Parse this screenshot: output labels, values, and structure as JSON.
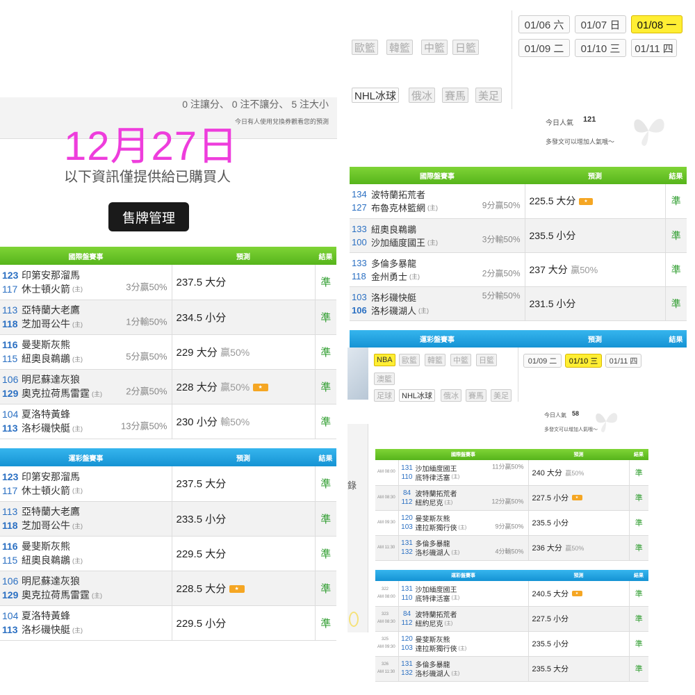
{
  "left": {
    "counts": "0 注讓分、 0 注不讓分、 5 注大小",
    "hint": "今日有人使用兌換券觀看您的預測",
    "date": "12月27日",
    "subtitle": "以下資訊僅提供給已購買人",
    "manage_button": "售牌管理",
    "tables": [
      {
        "title": "國際盤賽事",
        "col_pred": "預測",
        "col_result": "結果",
        "rows": [
          {
            "n1": "123",
            "t1": "印第安那溜馬",
            "n2": "117",
            "t2": "休士頓火箭",
            "host": "(主)",
            "host_row": 2,
            "bold": 1,
            "note": "3分贏50%",
            "pred": "237.5 大分",
            "pct": "",
            "badge": false,
            "result": "準"
          },
          {
            "n1": "113",
            "t1": "亞特蘭大老鷹",
            "n2": "118",
            "t2": "芝加哥公牛",
            "host": "(主)",
            "host_row": 2,
            "bold": 2,
            "note": "1分輸50%",
            "pred": "234.5 小分",
            "pct": "",
            "badge": false,
            "result": "準"
          },
          {
            "n1": "116",
            "t1": "曼斐斯灰熊",
            "n2": "115",
            "t2": "紐奧良鵜鶘",
            "host": "(主)",
            "host_row": 2,
            "bold": 1,
            "note": "5分贏50%",
            "pred": "229 大分",
            "pct": "贏50%",
            "badge": false,
            "result": "準"
          },
          {
            "n1": "106",
            "t1": "明尼蘇達灰狼",
            "n2": "129",
            "t2": "奧克拉荷馬雷霆",
            "host": "(主)",
            "host_row": 2,
            "bold": 2,
            "note": "2分贏50%",
            "pred": "228 大分",
            "pct": "贏50%",
            "badge": true,
            "result": "準"
          },
          {
            "n1": "104",
            "t1": "夏洛特黃蜂",
            "n2": "113",
            "t2": "洛杉磯快艇",
            "host": "(主)",
            "host_row": 2,
            "bold": 2,
            "note": "13分贏50%",
            "pred": "230 小分",
            "pct": "輸50%",
            "badge": false,
            "result": "準"
          }
        ]
      },
      {
        "title": "運彩盤賽事",
        "col_pred": "預測",
        "col_result": "結果",
        "rows": [
          {
            "n1": "123",
            "t1": "印第安那溜馬",
            "n2": "117",
            "t2": "休士頓火箭",
            "host": "(主)",
            "host_row": 2,
            "bold": 1,
            "note": "",
            "pred": "237.5 大分",
            "pct": "",
            "badge": false,
            "result": "準"
          },
          {
            "n1": "113",
            "t1": "亞特蘭大老鷹",
            "n2": "118",
            "t2": "芝加哥公牛",
            "host": "(主)",
            "host_row": 2,
            "bold": 2,
            "note": "",
            "pred": "233.5 小分",
            "pct": "",
            "badge": false,
            "result": "準"
          },
          {
            "n1": "116",
            "t1": "曼斐斯灰熊",
            "n2": "115",
            "t2": "紐奧良鵜鶘",
            "host": "(主)",
            "host_row": 2,
            "bold": 1,
            "note": "",
            "pred": "229.5 大分",
            "pct": "",
            "badge": false,
            "result": "準"
          },
          {
            "n1": "106",
            "t1": "明尼蘇達灰狼",
            "n2": "129",
            "t2": "奧克拉荷馬雷霆",
            "host": "(主)",
            "host_row": 2,
            "bold": 2,
            "note": "",
            "pred": "228.5 大分",
            "pct": "",
            "badge": true,
            "result": "準"
          },
          {
            "n1": "104",
            "t1": "夏洛特黃蜂",
            "n2": "113",
            "t2": "洛杉磯快艇",
            "host": "(主)",
            "host_row": 2,
            "bold": 2,
            "note": "",
            "pred": "229.5 小分",
            "pct": "",
            "badge": false,
            "result": "準"
          }
        ]
      }
    ]
  },
  "rtop": {
    "dates": [
      "01/06 六",
      "01/07 日",
      "01/08 一",
      "01/09 二",
      "01/10 三",
      "01/11 四"
    ],
    "sports_row1": [
      "歐籃",
      "韓籃",
      "中籃",
      "日籃"
    ],
    "sports_row2": [
      "NHL冰球",
      "俄冰",
      "賽馬",
      "美足"
    ],
    "pop_label": "今日人氣",
    "pop_value": "121",
    "pop_hint": "多發文可以增加人氣哦～",
    "table": {
      "title": "國際盤賽事",
      "col_pred": "預測",
      "col_result": "結果",
      "rows": [
        {
          "n1": "134",
          "t1": "波特蘭拓荒者",
          "n2": "127",
          "t2": "布魯克林籃網",
          "host": "(主)",
          "host_row": 2,
          "bold": 0,
          "note": "9分贏50%",
          "note_row": 2,
          "pred": "225.5 大分",
          "pct": "",
          "badge": true,
          "result": "準"
        },
        {
          "n1": "133",
          "t1": "紐奧良鵜鶘",
          "n2": "100",
          "t2": "沙加緬度國王",
          "host": "(主)",
          "host_row": 2,
          "bold": 0,
          "note": "3分輸50%",
          "note_row": 2,
          "pred": "235.5 小分",
          "pct": "",
          "badge": false,
          "result": "準"
        },
        {
          "n1": "133",
          "t1": "多倫多暴龍",
          "n2": "118",
          "t2": "金州勇士",
          "host": "(主)",
          "host_row": 2,
          "bold": 0,
          "note": "2分贏50%",
          "note_row": 2,
          "pred": "237 大分",
          "pct": "贏50%",
          "badge": false,
          "result": "準"
        },
        {
          "n1": "103",
          "t1": "洛杉磯快艇",
          "n2": "106",
          "t2": "洛杉磯湖人",
          "host": "(主)",
          "host_row": 2,
          "bold": 2,
          "note": "5分輸50%",
          "note_row": 1,
          "pred": "231.5 小分",
          "pct": "",
          "badge": false,
          "result": "準"
        }
      ]
    },
    "blue_header": {
      "title": "運彩盤賽事",
      "col_pred": "預測",
      "col_result": "結果"
    }
  },
  "rbot": {
    "dates": [
      "01/09 二",
      "01/10 三",
      "01/11 四"
    ],
    "sports_row1": [
      "NBA",
      "歐籃",
      "韓籃",
      "中籃",
      "日籃"
    ],
    "sports_row2": [
      "澳籃"
    ],
    "sports_row3": [
      "足球",
      "NHL冰球",
      "俄冰",
      "賽馬",
      "美足"
    ],
    "side_text": "錄",
    "pop_label": "今日人氣",
    "pop_value": "58",
    "pop_hint": "多發文可以增加人氣哦～",
    "tables": [
      {
        "title": "國際盤賽事",
        "col_pred": "預測",
        "col_result": "結果",
        "rows": [
          {
            "code": "",
            "time": "AM 08:00",
            "n1": "131",
            "t1": "沙加緬度國王",
            "n2": "110",
            "t2": "底特律活塞",
            "host": "(主)",
            "note": "11分贏50%",
            "note_row": 1,
            "pred": "240 大分",
            "pct": "贏50%",
            "badge": false,
            "result": "準"
          },
          {
            "code": "",
            "time": "AM 08:30",
            "n1": "84",
            "t1": "波特蘭拓荒者",
            "n2": "112",
            "t2": "紐約尼克",
            "host": "(主)",
            "note": "12分贏50%",
            "note_row": 2,
            "pred": "227.5 小分",
            "pct": "",
            "badge": true,
            "result": "準"
          },
          {
            "code": "",
            "time": "AM 09:30",
            "n1": "120",
            "t1": "曼斐斯灰熊",
            "n2": "103",
            "t2": "達拉斯獨行俠",
            "host": "(主)",
            "note": "9分贏50%",
            "note_row": 2,
            "pred": "235.5 小分",
            "pct": "",
            "badge": false,
            "result": "準"
          },
          {
            "code": "",
            "time": "AM 11:30",
            "n1": "131",
            "t1": "多倫多暴龍",
            "n2": "132",
            "t2": "洛杉磯湖人",
            "host": "(主)",
            "note": "4分輸50%",
            "note_row": 2,
            "pred": "236 大分",
            "pct": "贏50%",
            "badge": false,
            "result": "準"
          }
        ]
      },
      {
        "title": "運彩盤賽事",
        "col_pred": "預測",
        "col_result": "結果",
        "rows": [
          {
            "code": "322",
            "time": "AM 08:00",
            "n1": "131",
            "t1": "沙加緬度國王",
            "n2": "110",
            "t2": "底特律活塞",
            "host": "(主)",
            "note": "",
            "note_row": 1,
            "pred": "240.5 大分",
            "pct": "",
            "badge": true,
            "result": "準"
          },
          {
            "code": "323",
            "time": "AM 08:30",
            "n1": "84",
            "t1": "波特蘭拓荒者",
            "n2": "112",
            "t2": "紐約尼克",
            "host": "(主)",
            "note": "",
            "note_row": 1,
            "pred": "227.5 小分",
            "pct": "",
            "badge": false,
            "result": "準"
          },
          {
            "code": "325",
            "time": "AM 09:30",
            "n1": "120",
            "t1": "曼斐斯灰熊",
            "n2": "103",
            "t2": "達拉斯獨行俠",
            "host": "(主)",
            "note": "",
            "note_row": 1,
            "pred": "235.5 小分",
            "pct": "",
            "badge": false,
            "result": "準"
          },
          {
            "code": "326",
            "time": "AM 11:30",
            "n1": "131",
            "t1": "多倫多暴龍",
            "n2": "132",
            "t2": "洛杉磯湖人",
            "host": "(主)",
            "note": "",
            "note_row": 1,
            "pred": "235.5 大分",
            "pct": "",
            "badge": false,
            "result": "準"
          }
        ]
      }
    ]
  },
  "colors": {
    "green_header": "#63bf22",
    "blue_header": "#1e9fe0",
    "date_pink": "#ee3ddc",
    "active_date": "#ffee33",
    "result_green": "#2d9c2d",
    "badge_orange": "#f5a623"
  },
  "icons": {
    "badge": "king-badge-icon",
    "butterfly": "butterfly-icon"
  }
}
